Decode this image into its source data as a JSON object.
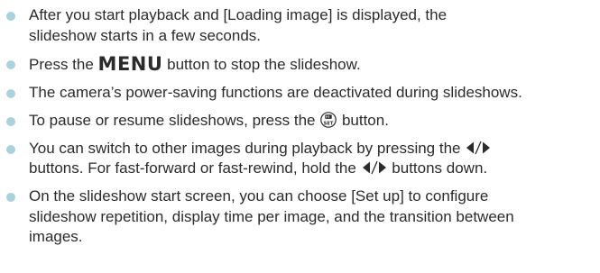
{
  "notes": [
    {
      "line1": "After you start playback and [Loading image] is displayed, the",
      "line2": "slideshow starts in a few seconds."
    },
    {
      "before": "Press the ",
      "key": "MENU",
      "after": " button to stop the slideshow."
    },
    {
      "text": "The camera’s power-saving functions are deactivated during slideshows."
    },
    {
      "before": "To pause or resume slideshows, press the ",
      "icon": "func-set-button-icon",
      "after": " button."
    },
    {
      "line1_before": "You can switch to other images during playback by pressing the ",
      "line1_icon": "left-right-arrows-icon",
      "line2_before": "buttons. For fast-forward or fast-rewind, hold the ",
      "line2_icon": "left-right-arrows-icon",
      "line2_after": " buttons down."
    },
    {
      "line1": "On the slideshow start screen, you can choose [Set up] to configure",
      "line2": "slideshow repetition, display time per image, and the transition between",
      "line3": "images."
    }
  ],
  "colors": {
    "bullet": "#a9d2dc",
    "text": "#2b2b2b"
  }
}
